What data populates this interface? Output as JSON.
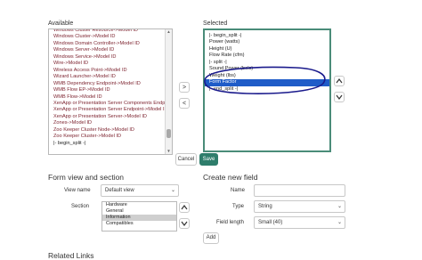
{
  "available": {
    "label": "Available",
    "items": [
      "Windows Cluster Resource->Model ID",
      "Windows Cluster->Model ID",
      "Windows Domain Controller->Model ID",
      "Windows Server->Model ID",
      "Windows Service->Model ID",
      "Wire->Model ID",
      "Wireless Access Point->Model ID",
      "Wizard Launcher->Model ID",
      "WMB Dependency Endpoint->Model ID",
      "WMB Flow EP->Model ID",
      "WMB Flow->Model ID",
      "XenApp or Presentation Server Components Endpoi",
      "XenApp or Presentation Server Endpoint->Model ID",
      "XenApp or Presentation Server->Model ID",
      "Zones->Model ID",
      "Zoo Keeper Cluster Node->Model ID",
      "Zoo Keeper Cluster->Model ID",
      "|- begin_split -|"
    ]
  },
  "selected": {
    "label": "Selected",
    "items": [
      "|- begin_split -|",
      "Power (watts)",
      "Height (U)",
      "Flow Rate (cfm)",
      "|- split -|",
      "Sound Power (bels)",
      "Weight (lbs)",
      "Form Factor",
      "|- end_split -|"
    ],
    "highlighted_index": 7
  },
  "move_buttons": {
    "add": ">",
    "remove": "<"
  },
  "order_buttons": {
    "up": "^",
    "down": "v"
  },
  "actions": {
    "cancel": "Cancel",
    "save": "Save"
  },
  "form_view": {
    "title": "Form view and section",
    "view_label": "View name",
    "view_value": "Default view",
    "section_label": "Section",
    "sections": [
      "Hardware",
      "General",
      "Information",
      "Compatibles"
    ],
    "selected_section": "Information"
  },
  "create_field": {
    "title": "Create new field",
    "name_label": "Name",
    "name_value": "",
    "type_label": "Type",
    "type_value": "String",
    "length_label": "Field length",
    "length_value": "Small (40)",
    "add_label": "Add"
  },
  "related_links": "Related Links",
  "colors": {
    "highlight": "#1f5cc8",
    "annotation": "#1a1a8c",
    "primary": "#2e7d6b"
  }
}
